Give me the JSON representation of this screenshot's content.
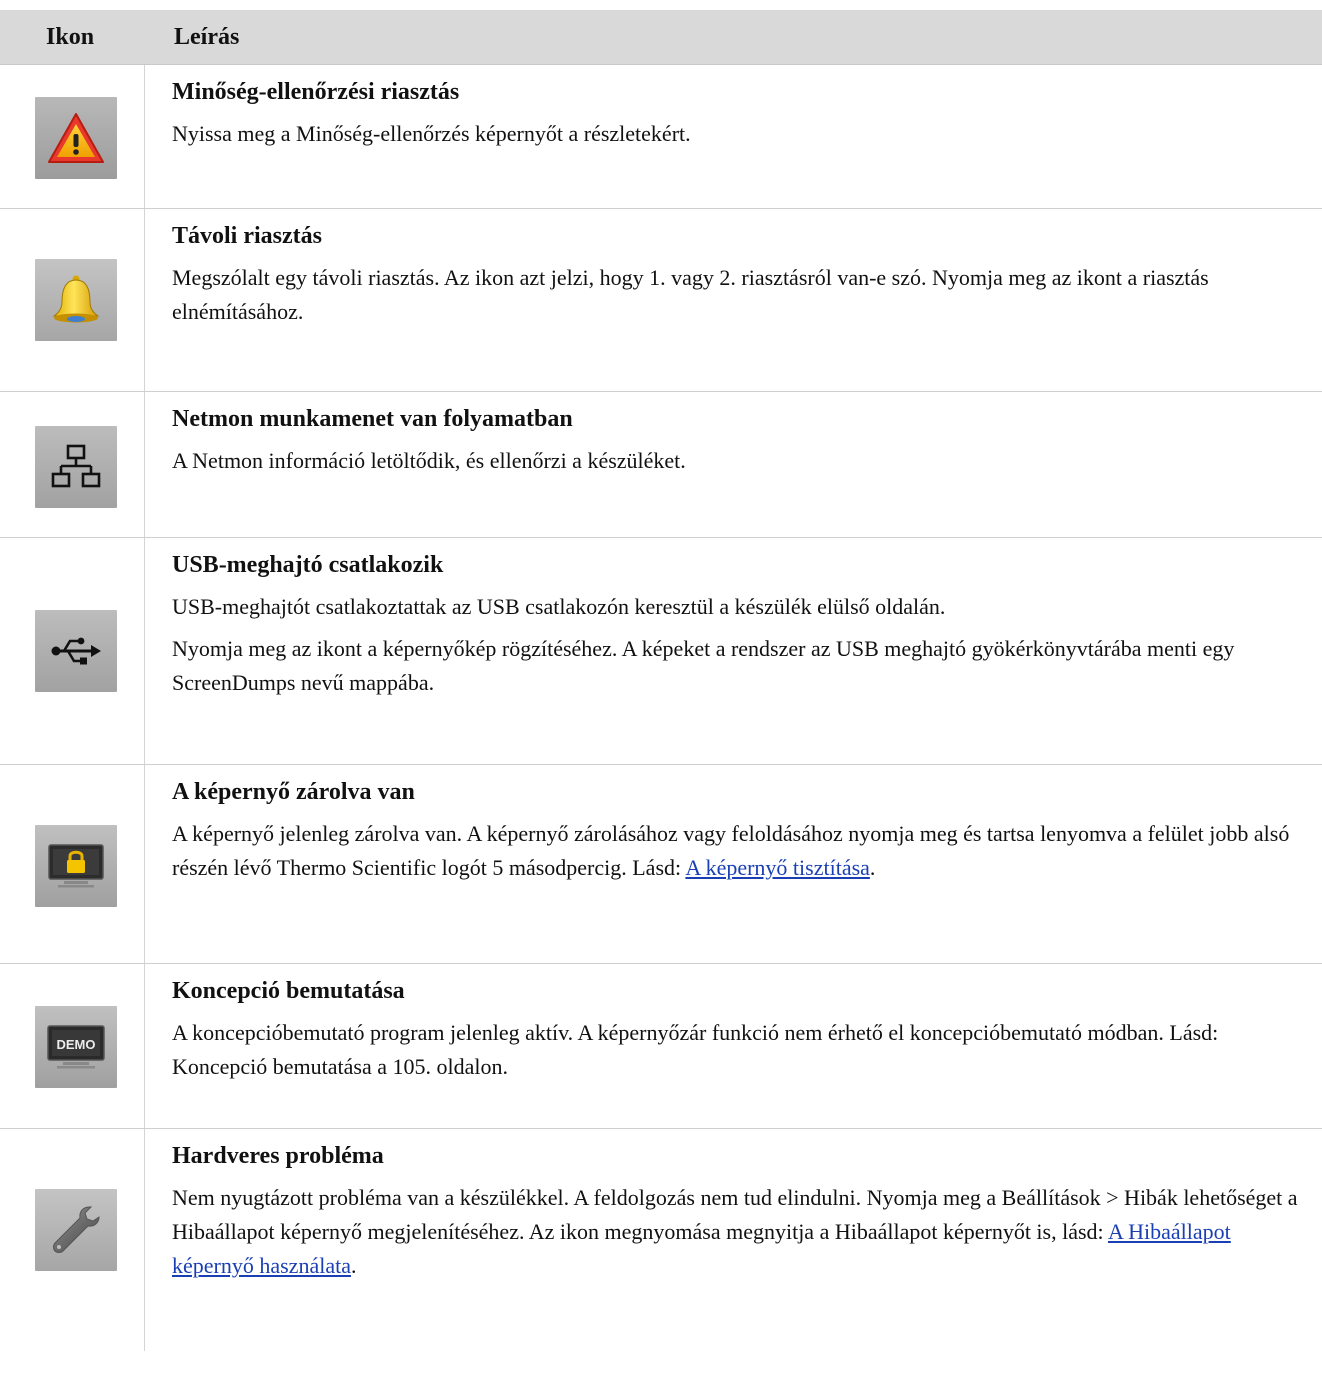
{
  "header": {
    "icon_col": "Ikon",
    "desc_col": "Leírás"
  },
  "rows": [
    {
      "icon": "warning-triangle-icon",
      "title": "Minőség-ellenőrzési riasztás",
      "text": "Nyissa meg a Minőség-ellenőrzés képernyőt a részletekért."
    },
    {
      "icon": "bell-icon",
      "title": "Távoli riasztás",
      "text": "Megszólalt egy távoli riasztás. Az ikon azt jelzi, hogy 1. vagy 2. riasztásról van-e szó. Nyomja meg az ikont a riasztás elnémításához."
    },
    {
      "icon": "network-icon",
      "title": "Netmon munkamenet van folyamatban",
      "text": "A Netmon információ letöltődik, és ellenőrzi a készüléket."
    },
    {
      "icon": "usb-icon",
      "title": "USB-meghajtó csatlakozik",
      "text": "USB-meghajtót csatlakoztattak az USB csatlakozón keresztül a készülék elülső oldalán.",
      "text2": "Nyomja meg az ikont a képernyőkép rögzítéséhez. A képeket a rendszer az USB meghajtó gyökérkönyvtárába menti egy ScreenDumps nevű mappába."
    },
    {
      "icon": "screen-lock-icon",
      "title": "A képernyő zárolva van",
      "text": "A képernyő jelenleg zárolva van. A képernyő zárolásához vagy feloldásához nyomja meg és tartsa lenyomva a felület jobb alsó részén lévő Thermo Scientific logót 5 másodpercig. Lásd: ",
      "link": "A képernyő tisztítása",
      "after": "."
    },
    {
      "icon": "demo-icon",
      "icon_label": "DEMO",
      "title": "Koncepció bemutatása",
      "text": "A koncepcióbemutató program jelenleg aktív. A képernyőzár funkció nem érhető el koncepcióbemutató módban. Lásd: Koncepció bemutatása a 105. oldalon."
    },
    {
      "icon": "wrench-icon",
      "title": "Hardveres probléma",
      "text": "Nem nyugtázott probléma van a készülékkel. A feldolgozás nem tud elindulni. Nyomja meg a Beállítások > Hibák lehetőséget a Hibaállapot képernyő megjelenítéséhez. Az ikon megnyomása megnyitja a Hibaállapot képernyőt is, lásd: ",
      "link": "A Hibaállapot képernyő használata",
      "after": "."
    }
  ]
}
